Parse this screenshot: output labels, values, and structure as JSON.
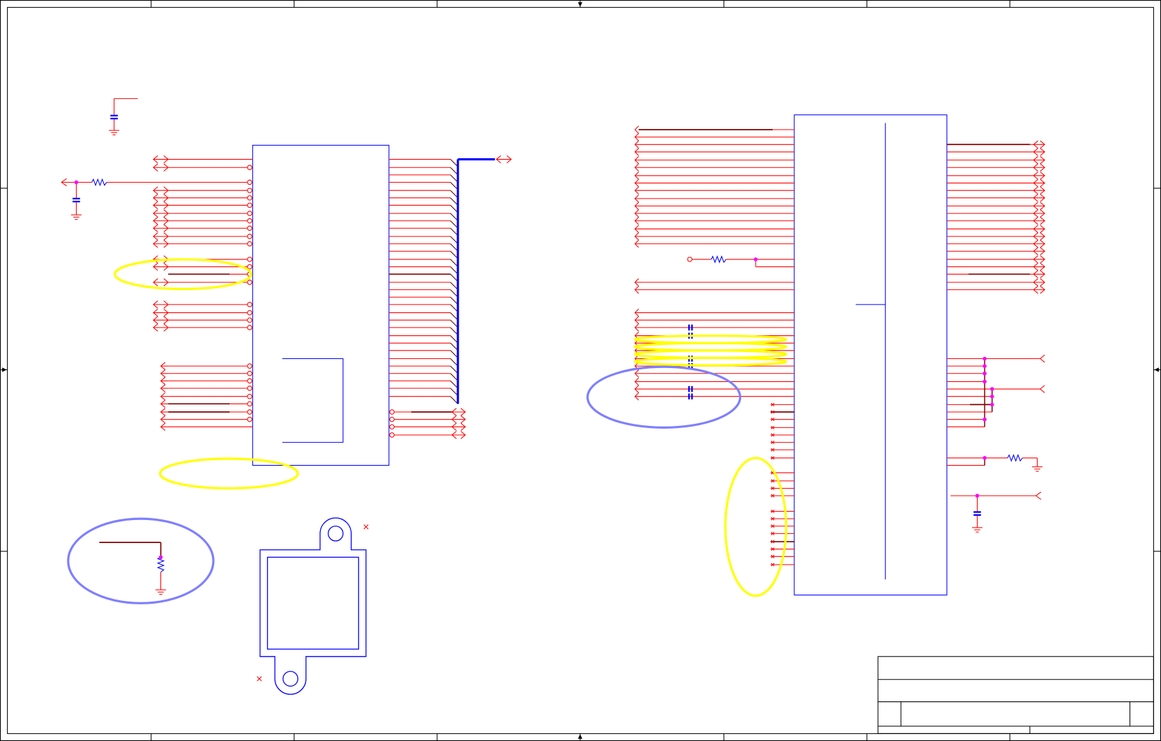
{
  "colors": {
    "background": "#ffffff",
    "frame": "#000000",
    "wire": "#ff0000",
    "bus_wire": "#800000",
    "bus_entry": "#600000",
    "component_outline": "#0000ff",
    "highlight_ellipse": "#ffff00",
    "annotation_ellipse": "#7f7fff",
    "junction": "#ff00ff"
  },
  "symbols": [
    "resistor-icon",
    "capacitor-icon",
    "ground-icon",
    "off-page-connector-icon",
    "no-connect-marker-icon",
    "junction-dot"
  ]
}
